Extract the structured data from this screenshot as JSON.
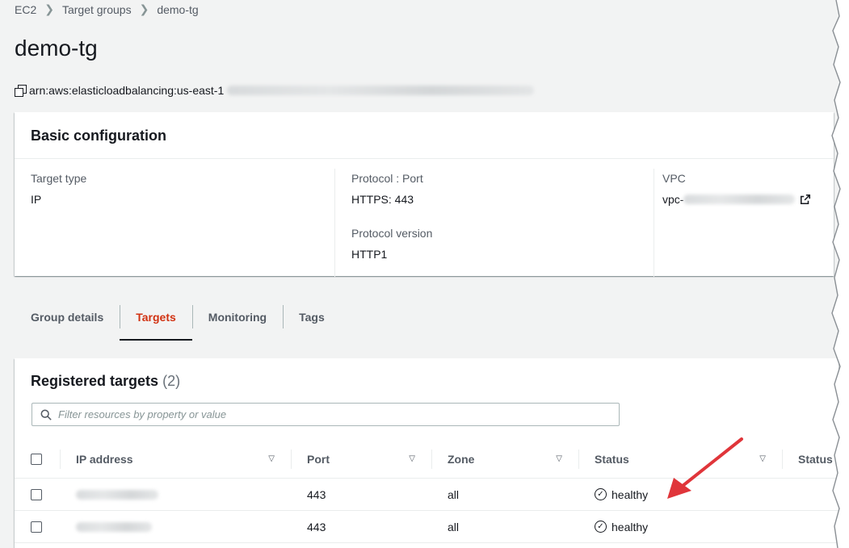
{
  "breadcrumb": {
    "items": [
      "EC2",
      "Target groups",
      "demo-tg"
    ]
  },
  "page_title": "demo-tg",
  "arn": {
    "prefix": "arn:aws:elasticloadbalancing:us-east-1"
  },
  "basic_config": {
    "title": "Basic configuration",
    "target_type_label": "Target type",
    "target_type_value": "IP",
    "protocol_port_label": "Protocol : Port",
    "protocol_port_value": "HTTPS: 443",
    "protocol_version_label": "Protocol version",
    "protocol_version_value": "HTTP1",
    "vpc_label": "VPC",
    "vpc_prefix": "vpc-"
  },
  "tabs": [
    {
      "label": "Group details",
      "active": false
    },
    {
      "label": "Targets",
      "active": true
    },
    {
      "label": "Monitoring",
      "active": false
    },
    {
      "label": "Tags",
      "active": false
    }
  ],
  "targets": {
    "title": "Registered targets",
    "count": "(2)",
    "filter_placeholder": "Filter resources by property or value",
    "columns": [
      "IP address",
      "Port",
      "Zone",
      "Status",
      "Status"
    ],
    "rows": [
      {
        "port": "443",
        "zone": "all",
        "status": "healthy"
      },
      {
        "port": "443",
        "zone": "all",
        "status": "healthy"
      }
    ]
  },
  "colors": {
    "accent_tab": "#d13212",
    "arrow": "#e0353a",
    "background": "#f2f3f3"
  },
  "icons": [
    "copy-icon",
    "external-link-icon",
    "search-icon",
    "sort-icon",
    "healthy-check-icon"
  ]
}
